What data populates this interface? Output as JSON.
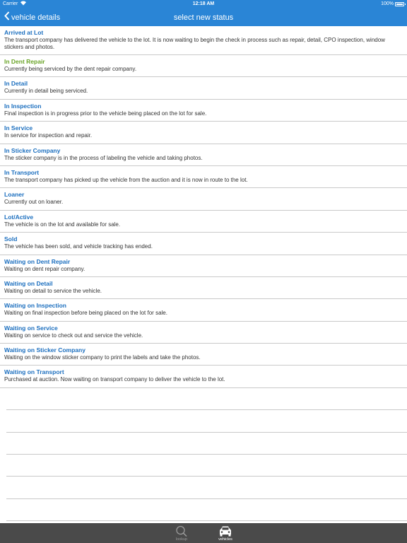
{
  "status_bar": {
    "carrier": "Carrier",
    "time": "12:18 AM",
    "battery": "100%"
  },
  "nav": {
    "back_label": "vehicle details",
    "title": "select new status"
  },
  "statuses": [
    {
      "name": "Arrived at Lot",
      "desc": "The transport company has delivered the vehicle to the lot. It is now waiting to begin the check in process such as repair, detail, CPO inspection, window stickers and photos."
    },
    {
      "name": "In Dent Repair",
      "desc": "Currently being serviced by the dent repair company."
    },
    {
      "name": "In Detail",
      "desc": "Currently in detail being serviced."
    },
    {
      "name": "In Inspection",
      "desc": "Final inspection is in progress prior to the vehicle being placed on the lot for sale."
    },
    {
      "name": "In Service",
      "desc": "In service for inspection and repair."
    },
    {
      "name": "In Sticker Company",
      "desc": "The sticker company is in the process of labeling the vehicle and taking photos."
    },
    {
      "name": "In Transport",
      "desc": "The transport company has picked up the vehicle from the auction and it is now in route to the lot."
    },
    {
      "name": "Loaner",
      "desc": "Currently out on loaner."
    },
    {
      "name": "Lot/Active",
      "desc": "The vehicle is on the lot and available for sale."
    },
    {
      "name": "Sold",
      "desc": "The vehicle has been sold, and vehicle tracking has ended."
    },
    {
      "name": "Waiting on Dent Repair",
      "desc": "Waiting on dent repair company."
    },
    {
      "name": "Waiting on Detail",
      "desc": "Waiting on detail to service the vehicle."
    },
    {
      "name": "Waiting on Inspection",
      "desc": "Waiting on final inspection before being placed on the lot for sale."
    },
    {
      "name": "Waiting on Service",
      "desc": "Waiting on service to check out and service the vehicle."
    },
    {
      "name": "Waiting on Sticker Company",
      "desc": "Waiting on the window sticker company to print the labels and take the photos."
    },
    {
      "name": "Waiting on Transport",
      "desc": "Purchased at auction. Now waiting on transport company to deliver the vehicle to the lot."
    }
  ],
  "colors": {
    "nav_blue": "#2a85d6",
    "status_blue": "#1c6fbf",
    "current_status_green": "#6aa428",
    "tabbar": "#4a4a4a"
  },
  "tabs": {
    "lookup": {
      "label": "lookup",
      "icon": "search-icon"
    },
    "vehicles": {
      "label": "vehicles",
      "icon": "car-icon"
    }
  }
}
